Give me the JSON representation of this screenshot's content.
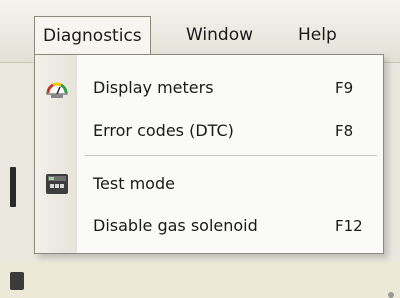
{
  "menubar": {
    "items": [
      {
        "label": "Diagnostics"
      },
      {
        "label": "Window"
      },
      {
        "label": "Help"
      }
    ]
  },
  "dropdown": {
    "items": [
      {
        "label": "Display meters",
        "shortcut": "F9",
        "icon": "gauge-icon"
      },
      {
        "label": "Error codes (DTC)",
        "shortcut": "F8"
      },
      {
        "label": "Test mode",
        "icon": "test-panel-icon"
      },
      {
        "label": "Disable gas solenoid",
        "shortcut": "F12"
      }
    ]
  },
  "colors": {
    "menu_background": "#fafaf8",
    "gauge_red": "#c0392b",
    "gauge_green": "#2f9e44",
    "gauge_yellow": "#f1c40f"
  }
}
